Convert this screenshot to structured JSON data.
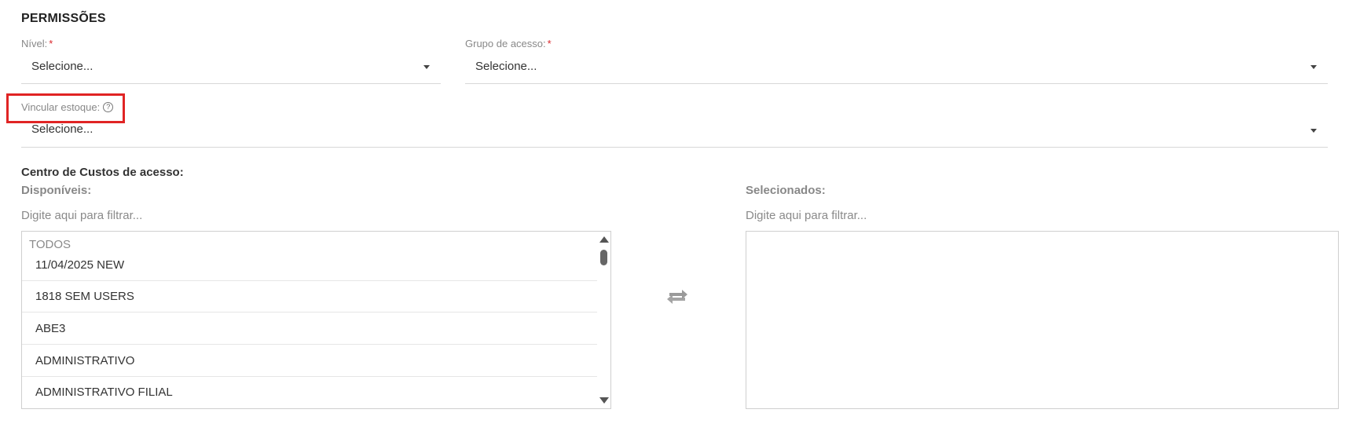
{
  "section": {
    "title": "PERMISSÕES"
  },
  "nivel": {
    "label": "Nível:",
    "required_mark": "*",
    "value": "Selecione..."
  },
  "grupo_acesso": {
    "label": "Grupo de acesso:",
    "required_mark": "*",
    "value": "Selecione..."
  },
  "vincular_estoque": {
    "label": "Vincular estoque:",
    "help_icon": "question-circle-icon",
    "value": "Selecione..."
  },
  "centro_custos": {
    "title": "Centro de Custos de acesso:",
    "available": {
      "label": "Disponíveis:",
      "filter_placeholder": "Digite aqui para filtrar...",
      "group_header": "TODOS",
      "items": [
        "11/04/2025 NEW",
        "1818 SEM USERS",
        "ABE3",
        "ADMINISTRATIVO",
        "ADMINISTRATIVO FILIAL"
      ]
    },
    "selected": {
      "label": "Selecionados:",
      "filter_placeholder": "Digite aqui para filtrar...",
      "items": []
    },
    "transfer_icon": "exchange-arrows-icon"
  },
  "colors": {
    "required": "#d9262b",
    "highlight": "#e02424"
  }
}
